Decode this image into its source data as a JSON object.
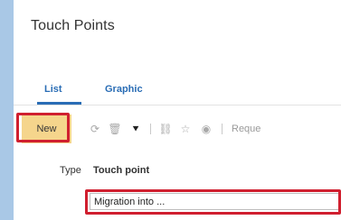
{
  "window": {
    "title": "Touch Points"
  },
  "tabs": [
    {
      "label": "List",
      "active": true
    },
    {
      "label": "Graphic",
      "active": false
    }
  ],
  "toolbar": {
    "new_label": "New",
    "icons": [
      "refresh-icon",
      "delete-icon",
      "hierarchy-icon",
      "link-icon",
      "favorite-add-icon",
      "watch-add-icon"
    ],
    "request_label": "Reque"
  },
  "table": {
    "columns": [
      "Type",
      "Touch point"
    ],
    "row_value": "Migration into ..."
  },
  "colors": {
    "accent": "#2a6db5",
    "highlight_border": "#d01f2f",
    "new_button_bg": "#f5d58c",
    "page_bg": "#a9c8e6"
  }
}
